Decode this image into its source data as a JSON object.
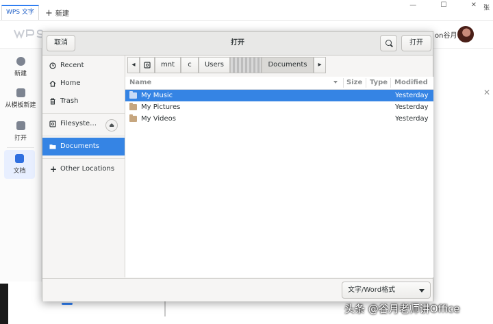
{
  "wps": {
    "tab_label": "WPS 文字",
    "new_tab_label": "新建",
    "window_controls": "— ☐ ✕",
    "corner_text": "张",
    "username": "on谷月",
    "sidebar": [
      {
        "label": "新建",
        "icon": "plus-circle-icon"
      },
      {
        "label": "从模板新建",
        "icon": "template-icon"
      },
      {
        "label": "打开",
        "icon": "folder-icon"
      },
      {
        "label": "文档",
        "icon": "document-icon"
      }
    ]
  },
  "dialog": {
    "title": "打开",
    "cancel_label": "取消",
    "open_label": "打开",
    "places": [
      {
        "label": "Recent",
        "icon": "clock-icon"
      },
      {
        "label": "Home",
        "icon": "home-icon"
      },
      {
        "label": "Trash",
        "icon": "trash-icon"
      },
      {
        "label": "Filesyste…",
        "icon": "drive-icon"
      },
      {
        "label": "Documents",
        "icon": "folder-icon"
      },
      {
        "label": "Other Locations",
        "icon": "plus-icon"
      }
    ],
    "path": [
      "mnt",
      "c",
      "Users",
      "",
      "Documents"
    ],
    "columns": {
      "name": "Name",
      "size": "Size",
      "type": "Type",
      "modified": "Modified"
    },
    "files": [
      {
        "name": "My Music",
        "modified": "Yesterday",
        "selected": true
      },
      {
        "name": "My Pictures",
        "modified": "Yesterday",
        "selected": false
      },
      {
        "name": "My Videos",
        "modified": "Yesterday",
        "selected": false
      }
    ],
    "filter_label": "文字/Word格式"
  },
  "watermark": "头条 @谷月老师讲Office",
  "colors": {
    "accent": "#3584e4",
    "wps_blue": "#2f7ef2"
  }
}
